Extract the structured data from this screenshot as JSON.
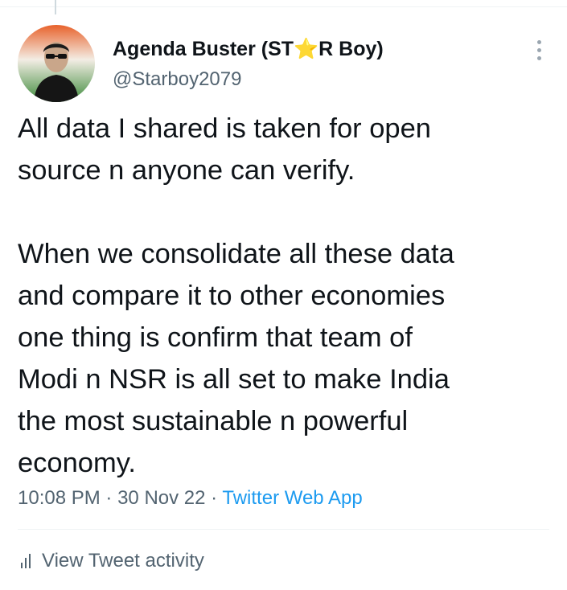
{
  "tweet": {
    "author_name": "Agenda Buster (ST",
    "author_star": "⭐",
    "author_name_suffix": "R Boy)",
    "handle": "@Starboy2079",
    "avatar_icon": "profile-avatar",
    "body_lines": [
      "All data I shared is taken for open",
      "source n anyone can verify.",
      "When we consolidate all these data",
      "and compare it to other economies",
      "one thing is confirm that team of",
      "Modi n NSR is all set to make India",
      "the most sustainable n powerful",
      "economy."
    ],
    "time": "10:08 PM",
    "separator": "·",
    "date": "30 Nov 22",
    "source": "Twitter Web App"
  },
  "actions": {
    "view_activity_label": "View Tweet activity",
    "activity_icon": "bar-chart-icon",
    "more_icon": "more-vertical-icon"
  },
  "colors": {
    "text": "#0f1419",
    "muted": "#536471",
    "link": "#1d9bf0",
    "divider": "#eff3f4"
  }
}
